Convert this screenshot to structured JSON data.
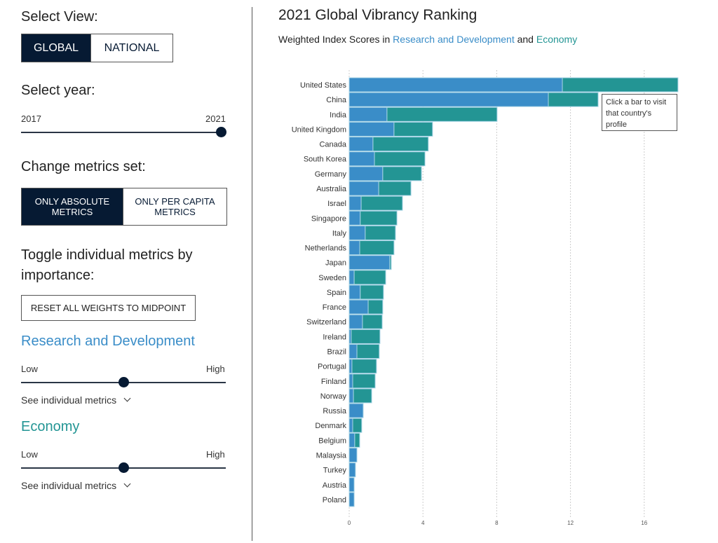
{
  "sidebar": {
    "select_view_label": "Select View:",
    "view_options": [
      "GLOBAL",
      "NATIONAL"
    ],
    "view_selected": "GLOBAL",
    "select_year_label": "Select year:",
    "year_min": "2017",
    "year_max": "2021",
    "year_value": 2021,
    "metrics_set_label": "Change metrics set:",
    "metrics_options": [
      "ONLY ABSOLUTE METRICS",
      "ONLY PER CAPITA METRICS"
    ],
    "metrics_selected": "ONLY ABSOLUTE METRICS",
    "toggle_label": "Toggle individual metrics by importance:",
    "reset_button": "RESET ALL WEIGHTS TO MIDPOINT",
    "categories": [
      {
        "name": "Research and Development",
        "color": "#3a8dc8",
        "low": "Low",
        "high": "High",
        "weight": 0.5,
        "see_more": "See individual metrics"
      },
      {
        "name": "Economy",
        "color": "#239594",
        "low": "Low",
        "high": "High",
        "weight": 0.5,
        "see_more": "See individual metrics"
      }
    ]
  },
  "header": {
    "title": "2021 Global Vibrancy Ranking",
    "subtitle_prefix": "Weighted Index Scores in ",
    "subtitle_rd": "Research and Development",
    "subtitle_and": " and ",
    "subtitle_econ": "Economy"
  },
  "tooltip": "Click a bar to visit that country's profile",
  "chart_data": {
    "type": "bar",
    "orientation": "horizontal",
    "stacked": true,
    "xlim": [
      0,
      17.8
    ],
    "xticks": [
      0,
      4,
      8,
      12,
      16
    ],
    "grid": true,
    "categories": [
      "United States",
      "China",
      "India",
      "United Kingdom",
      "Canada",
      "South Korea",
      "Germany",
      "Australia",
      "Israel",
      "Singapore",
      "Italy",
      "Netherlands",
      "Japan",
      "Sweden",
      "Spain",
      "France",
      "Switzerland",
      "Ireland",
      "Brazil",
      "Portugal",
      "Finland",
      "Norway",
      "Russia",
      "Denmark",
      "Belgium",
      "Malaysia",
      "Turkey",
      "Austria",
      "Poland"
    ],
    "series": [
      {
        "name": "Research and Development",
        "color": "#3a8dc8",
        "values": [
          11.56,
          10.8,
          2.05,
          2.43,
          1.29,
          1.37,
          1.82,
          1.6,
          0.65,
          0.6,
          0.87,
          0.57,
          2.2,
          0.27,
          0.6,
          1.03,
          0.72,
          0.11,
          0.42,
          0.15,
          0.19,
          0.23,
          0.76,
          0.19,
          0.3,
          0.42,
          0.34,
          0.27,
          0.27
        ]
      },
      {
        "name": "Economy",
        "color": "#239594",
        "values": [
          6.27,
          2.7,
          5.97,
          2.09,
          3.0,
          2.74,
          2.1,
          1.75,
          2.24,
          1.99,
          1.64,
          1.86,
          0.08,
          1.71,
          1.26,
          0.79,
          1.07,
          1.56,
          1.21,
          1.33,
          1.22,
          0.99,
          0,
          0.49,
          0.27,
          0,
          0,
          0,
          0
        ]
      }
    ]
  }
}
